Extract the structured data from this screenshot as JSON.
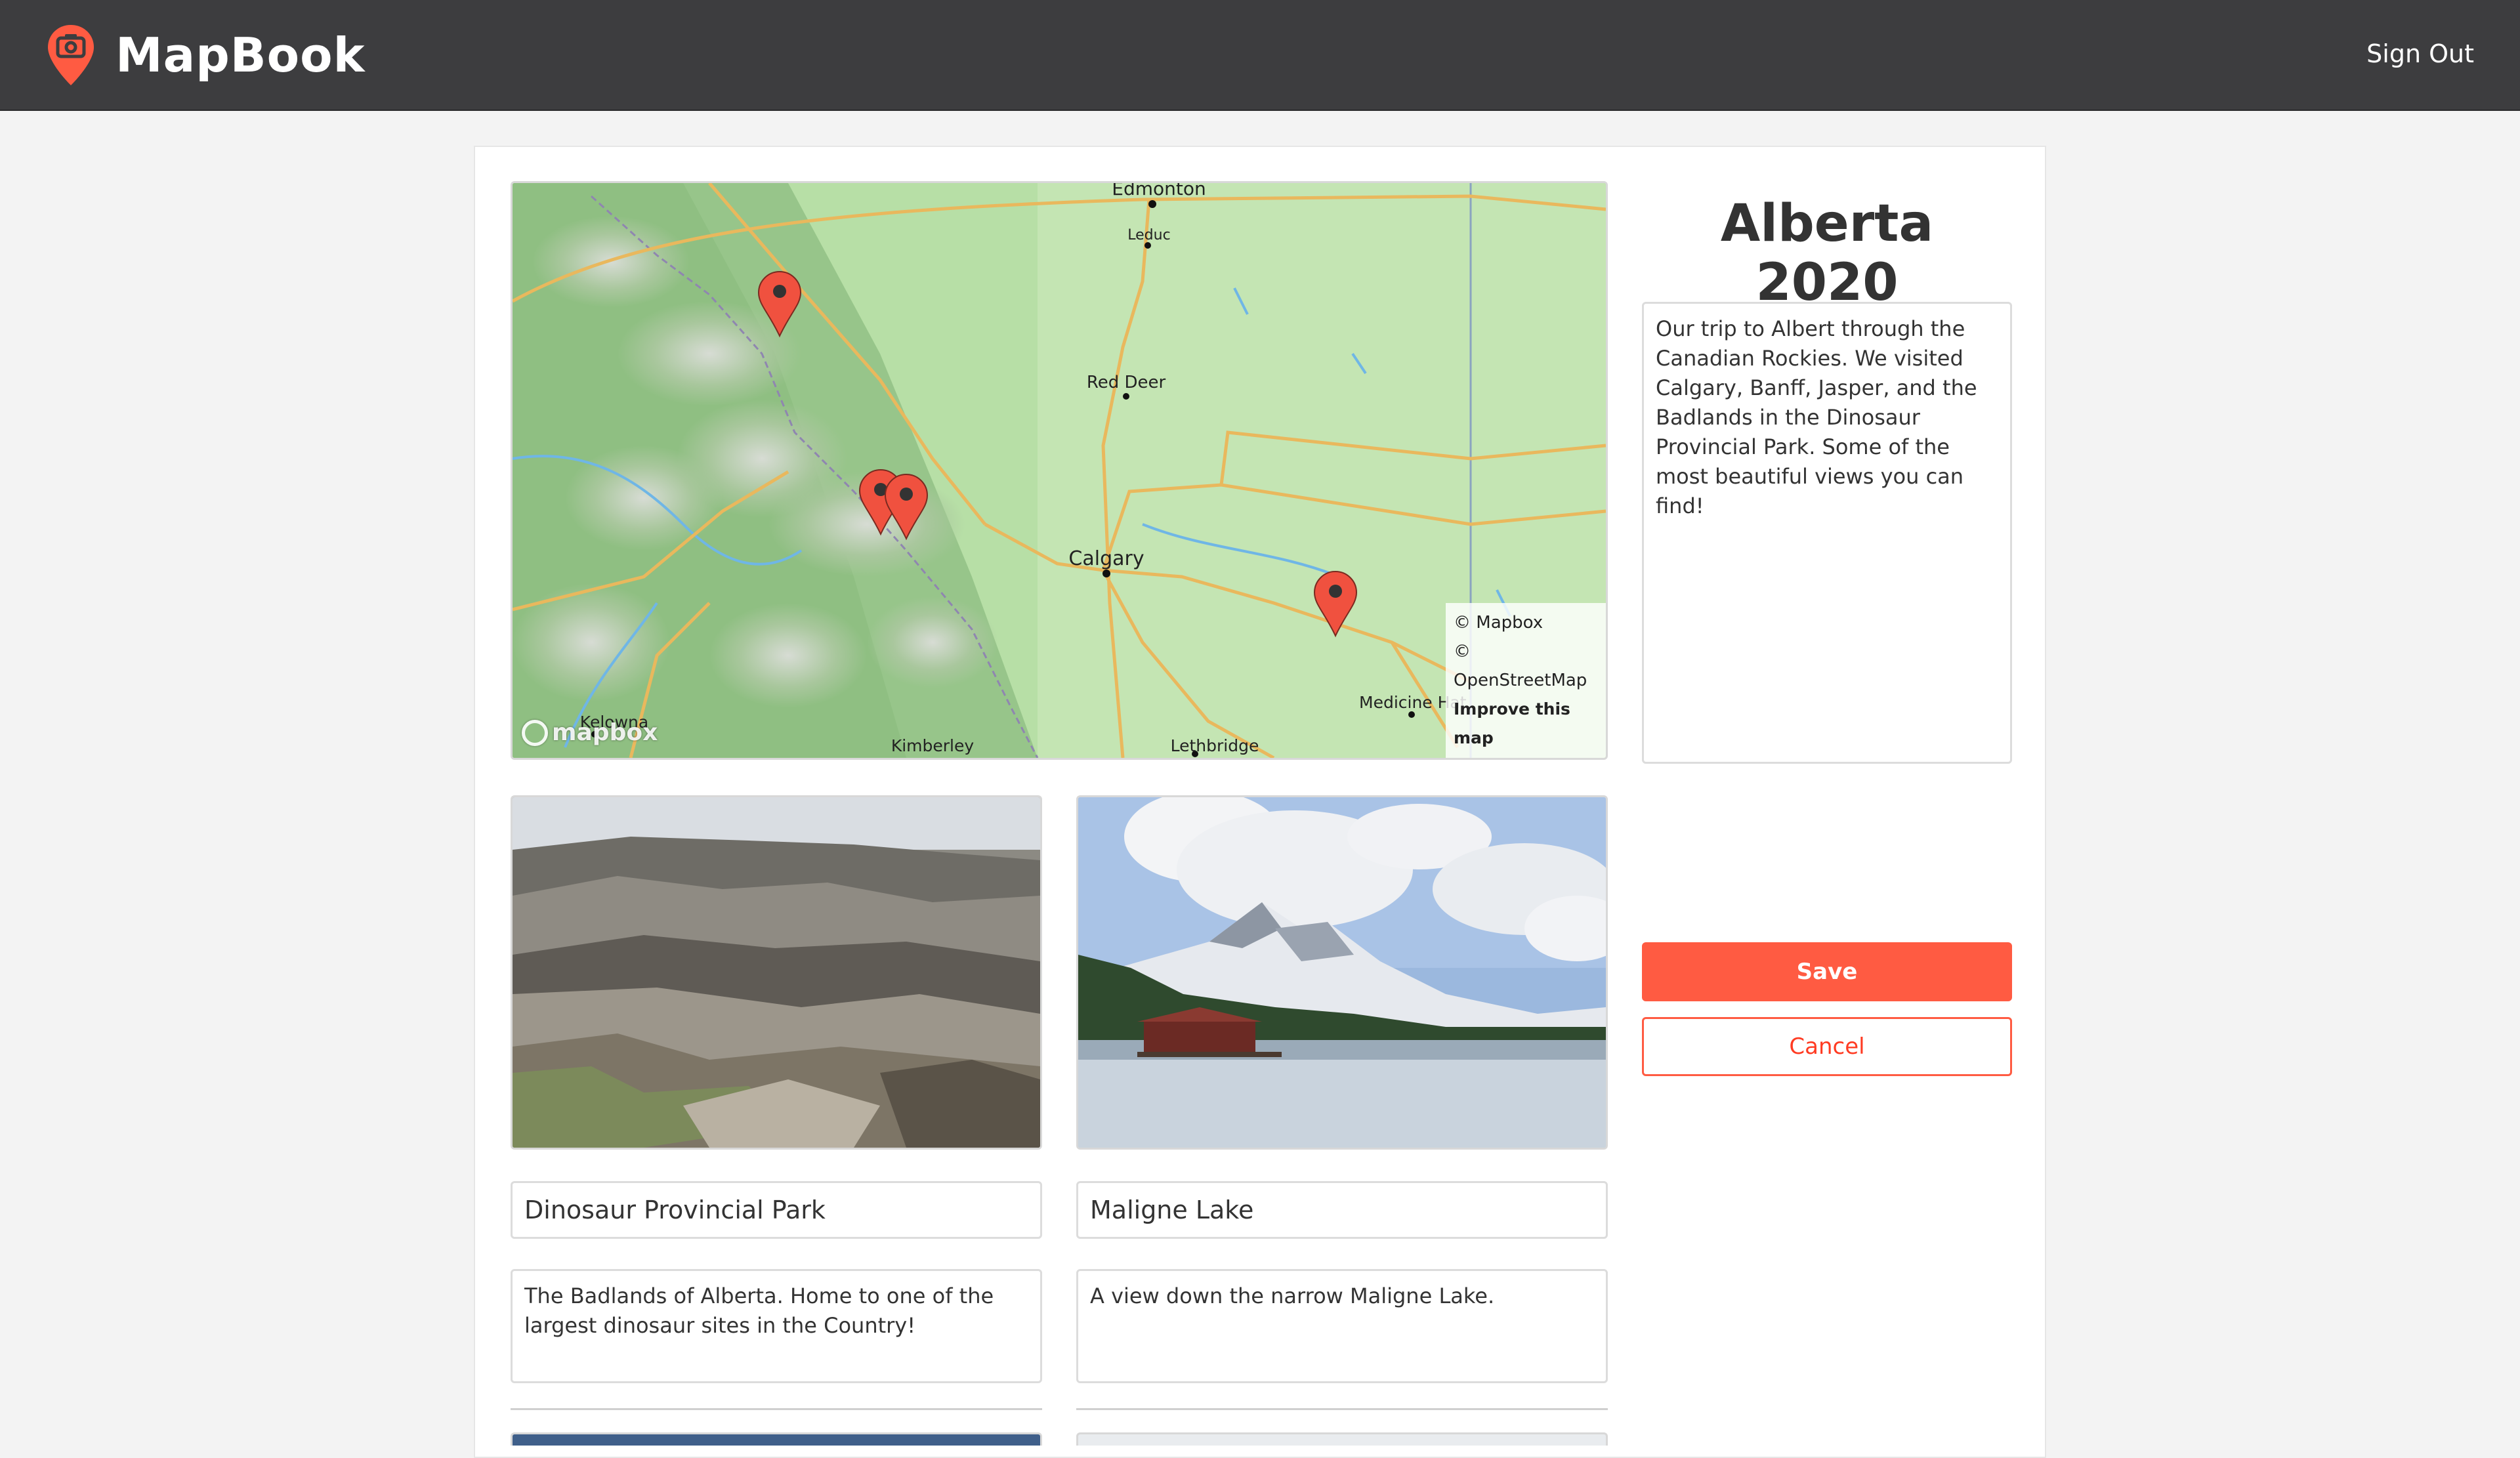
{
  "app": {
    "name": "MapBook",
    "sign_out_label": "Sign Out",
    "accent_color": "#ff5b42",
    "header_color": "#3d3d3f"
  },
  "map": {
    "place_labels": {
      "edmonton": "Edmonton",
      "leduc": "Leduc",
      "red_deer": "Red Deer",
      "calgary": "Calgary",
      "medicine_hat": "Medicine Hat",
      "lethbridge": "Lethbridge",
      "kimberley": "Kimberley",
      "kelowna": "Kelowna"
    },
    "attribution": {
      "mapbox": "© Mapbox",
      "osm": "© OpenStreetMap",
      "improve": "Improve this map"
    },
    "logo_text": "mapbox",
    "marker_icon": "map-pin-icon",
    "marker_count": 4
  },
  "trip": {
    "title": "Alberta 2020",
    "description": "Our trip to Albert through the Canadian Rockies. We visited Calgary, Banff, Jasper, and the Badlands in the Dinosaur Provincial Park. Some of the most beautiful views you can find!"
  },
  "actions": {
    "save_label": "Save",
    "cancel_label": "Cancel"
  },
  "photos": [
    {
      "title": "Dinosaur Provincial Park",
      "description": "The Badlands of Alberta. Home to one of the largest dinosaur sites in the Country!"
    },
    {
      "title": "Maligne Lake",
      "description": "A view down the narrow Maligne Lake."
    }
  ]
}
